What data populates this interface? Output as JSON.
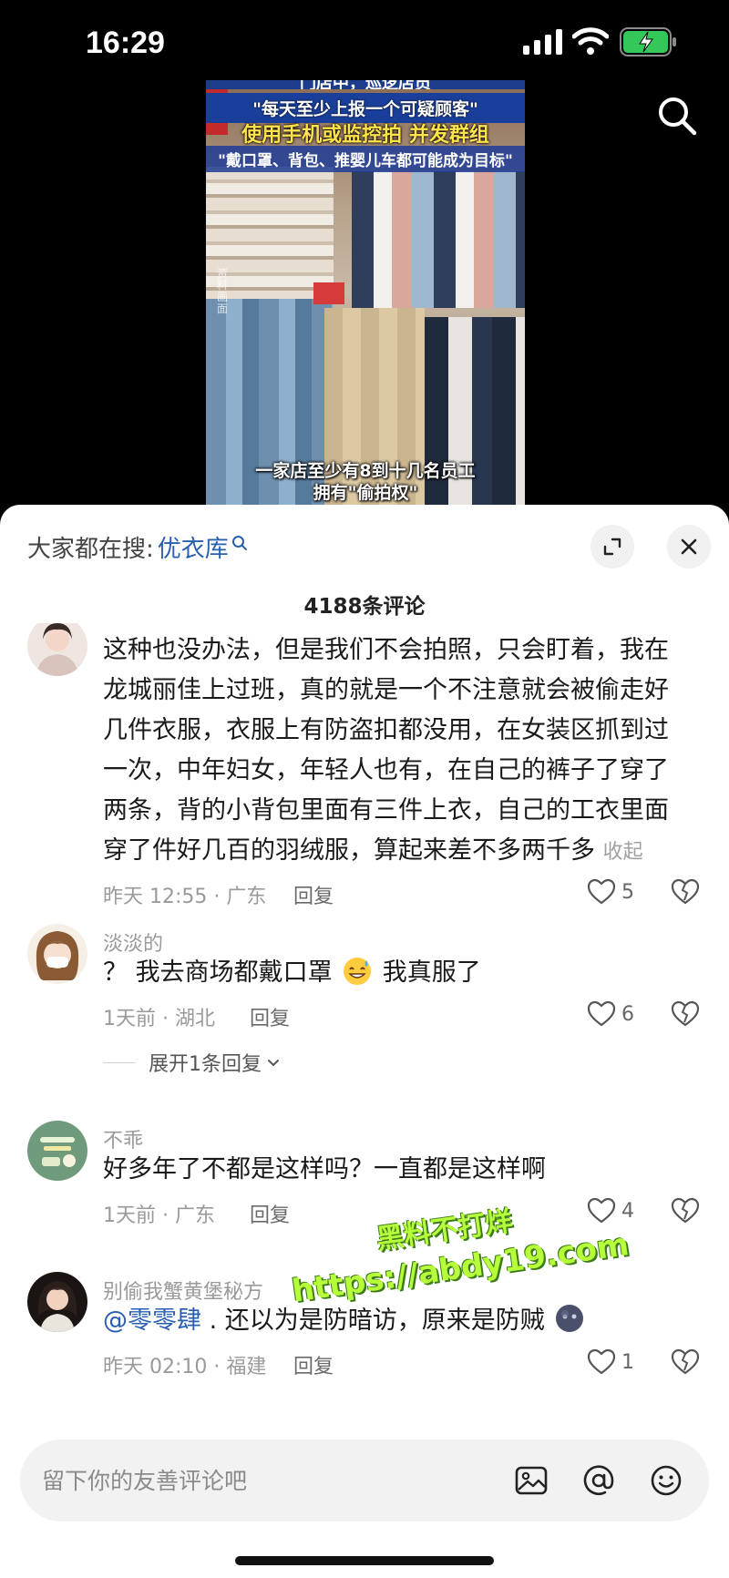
{
  "status_bar": {
    "time": "16:29",
    "icons": [
      "cellular-signal-icon",
      "wifi-icon",
      "battery-charging-icon"
    ],
    "battery_color": "#34c759"
  },
  "video": {
    "headline_top": "门店中，巡逻店员",
    "headline_lines": [
      "\"每天至少上报一个可疑顾客\"",
      "使用手机或监控拍 并发群组",
      "\"戴口罩、背包、推婴儿车都可能成为目标\""
    ],
    "side_watermark": "资料画面",
    "subtitle_lines": [
      "一家店至少有8到十几名员工",
      "拥有\"偷拍权\""
    ]
  },
  "sheet": {
    "search_hint_prefix": "大家都在搜:",
    "search_hint_keyword": "优衣库",
    "comment_count": "4188条评论",
    "accent_color": "#2a5fb0"
  },
  "comments": [
    {
      "username": "",
      "text": "这种也没办法，但是我们不会拍照，只会盯着，我在龙城丽佳上过班，真的就是一个不注意就会被偷走好几件衣服，衣服上有防盗扣都没用，在女装区抓到过一次，中年妇女，年轻人也有，在自己的裤子了穿了两条，背的小背包里面有三件上衣，自己的工衣里面穿了件好几百的羽绒服，算起来差不多两千多",
      "collapse_label": "收起",
      "meta": "昨天 12:55 · 广东",
      "reply_label": "回复",
      "likes": "5"
    },
    {
      "username": "淡淡的",
      "text_before": "？ 我去商场都戴口罩",
      "emoji": "sweat-smile-emoji",
      "text_after": "我真服了",
      "meta": "1天前 · 湖北",
      "reply_label": "回复",
      "likes": "6",
      "expand_label": "展开1条回复"
    },
    {
      "username": "不乖",
      "text": "好多年了不都是这样吗？一直都是这样啊",
      "meta": "1天前 · 广东",
      "reply_label": "回复",
      "likes": "4"
    },
    {
      "username": "别偷我蟹黄堡秘方",
      "mention": "@零零肆",
      "text": ". 还以为是防暗访，原来是防贼",
      "emoji": "dark-face-emoji",
      "meta": "昨天 02:10 · 福建",
      "reply_label": "回复",
      "likes": "1"
    }
  ],
  "overlay_watermark": {
    "line1": "黑料不打烊",
    "line2": "https://abdy19.com"
  },
  "input_bar": {
    "placeholder": "留下你的友善评论吧",
    "icons": [
      "image-icon",
      "at-icon",
      "emoji-icon"
    ]
  }
}
